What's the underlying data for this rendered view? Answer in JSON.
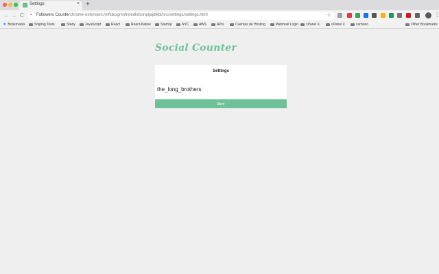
{
  "browser": {
    "tab": {
      "title": "Settings",
      "close_glyph": "×",
      "new_tab_glyph": "+"
    },
    "toolbar": {
      "back_glyph": "←",
      "forward_glyph": "→",
      "reload_glyph": "C",
      "site_name": "Followers Counter",
      "url_separator": "|",
      "url": "chrome-extension://nfkbcigmnfnoedkdlcinpijajdikbl/src/settings/settings.html",
      "star_glyph": "☆",
      "menu_glyph": "⋮"
    },
    "bookmarks": [
      {
        "label": "Bookmarks",
        "icon": "star-icon"
      },
      {
        "label": "Sniping Tools",
        "icon": "folder-icon"
      },
      {
        "label": "Study",
        "icon": "folder-icon"
      },
      {
        "label": "JavaScript",
        "icon": "folder-icon"
      },
      {
        "label": "React",
        "icon": "folder-icon"
      },
      {
        "label": "React-Native",
        "icon": "folder-icon"
      },
      {
        "label": "StartUp",
        "icon": "folder-icon"
      },
      {
        "label": "NYC",
        "icon": "folder-icon"
      },
      {
        "label": "AWS",
        "icon": "folder-icon"
      },
      {
        "label": "APIs",
        "icon": "folder-icon"
      },
      {
        "label": "Cuentas de Hosting",
        "icon": "doc-icon"
      },
      {
        "label": "Webmail Login",
        "icon": "webmail-icon"
      },
      {
        "label": "cPanel X",
        "icon": "cpanel-icon"
      },
      {
        "label": "cPanel X",
        "icon": "cpanel-icon"
      },
      {
        "label": "carbono",
        "icon": "carbono-icon"
      },
      {
        "label": "Other Bookmarks",
        "icon": "folder-icon"
      }
    ],
    "extension_colors": [
      "#9aa0a6",
      "#e03a3a",
      "#34a853",
      "#1a73e8",
      "#555555",
      "#f4b400",
      "#0f9d58",
      "#777777",
      "#c5221f",
      "#5f6368"
    ]
  },
  "page": {
    "logo_text": "Social Counter",
    "settings": {
      "title": "Settings",
      "username_value": "the_long_brothers",
      "save_label": "Save"
    }
  },
  "colors": {
    "accent": "#6fc297",
    "background": "#efefef"
  }
}
